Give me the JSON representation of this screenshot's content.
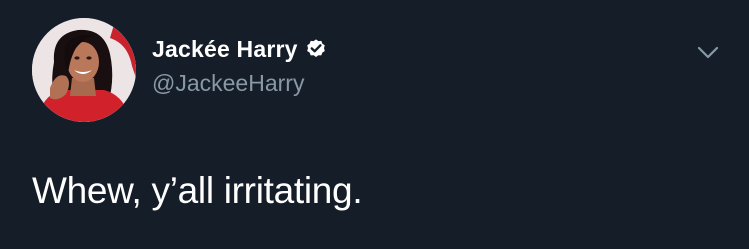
{
  "tweet": {
    "author": {
      "display_name": "Jackée Harry",
      "handle": "@JackeeHarry",
      "verified": true
    },
    "text": "Whew, y’all irritating.",
    "icons": {
      "verified": "verified-badge-icon",
      "menu": "chevron-down-icon"
    }
  },
  "colors": {
    "background": "#151d28",
    "text_primary": "#ffffff",
    "text_secondary": "#8899a6"
  }
}
